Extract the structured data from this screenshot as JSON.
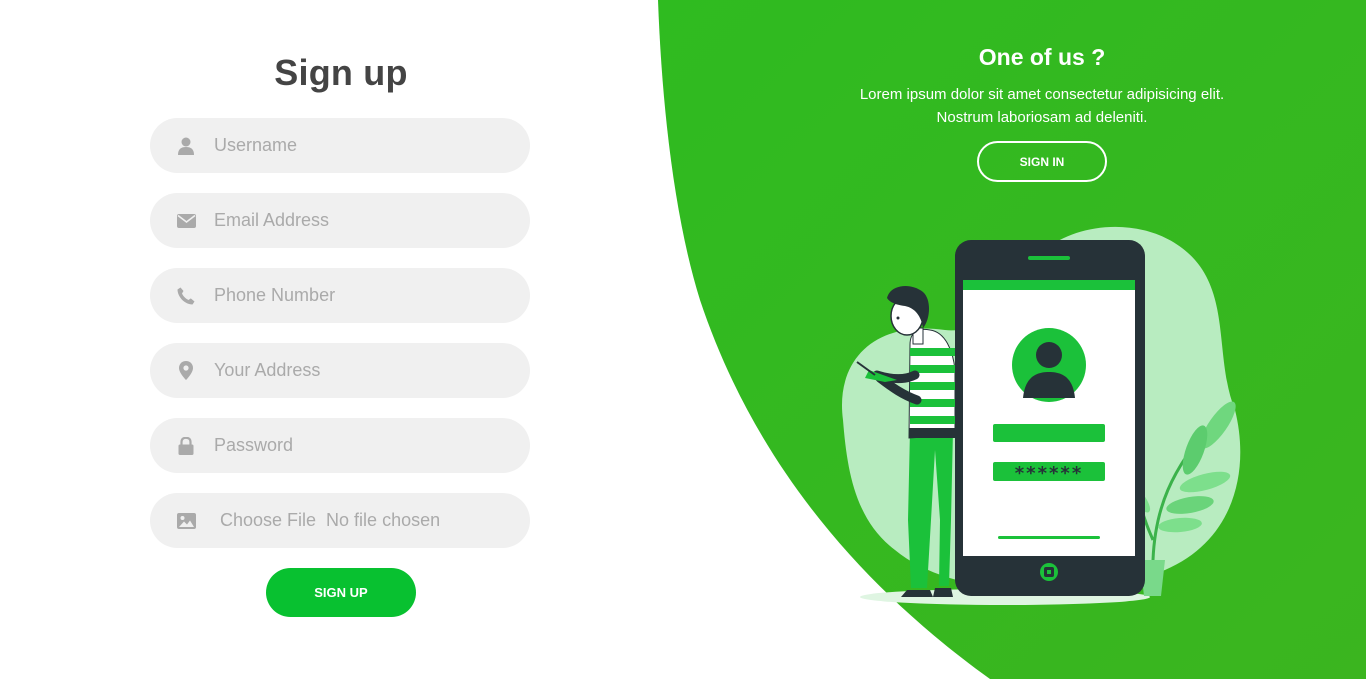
{
  "form": {
    "title": "Sign up",
    "fields": [
      {
        "placeholder": "Username",
        "icon": "user-icon"
      },
      {
        "placeholder": "Email Address",
        "icon": "envelope-icon"
      },
      {
        "placeholder": "Phone Number",
        "icon": "phone-icon"
      },
      {
        "placeholder": "Your Address",
        "icon": "map-marker-icon"
      },
      {
        "placeholder": "Password",
        "icon": "lock-icon"
      }
    ],
    "file": {
      "icon": "image-icon",
      "button_label": "Choose File",
      "status": "No file chosen"
    },
    "submit_label": "SIGN UP"
  },
  "promo": {
    "title": "One of us ?",
    "text_line1": "Lorem ipsum dolor sit amet consectetur adipisicing elit.",
    "text_line2": "Nostrum laboriosam ad deleniti.",
    "signin_label": "SIGN IN",
    "password_mask": "******"
  },
  "colors": {
    "brand_green": "#33bb22",
    "button_green": "#08c130",
    "field_bg": "#f0f0f0",
    "icon_gray": "#aaaaaa",
    "title_gray": "#444444"
  }
}
